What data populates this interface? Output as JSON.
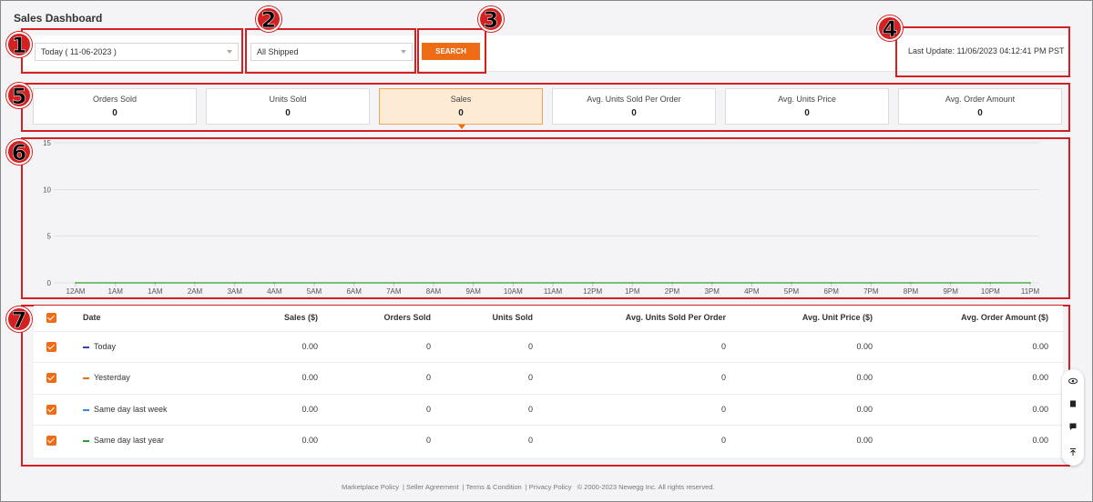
{
  "page": {
    "title": "Sales Dashboard"
  },
  "filters": {
    "date_range": "Today ( 11-06-2023 )",
    "status": "All Shipped",
    "search_label": "SEARCH",
    "last_update": "Last Update: 11/06/2023 04:12:41 PM PST"
  },
  "callouts": [
    "1",
    "2",
    "3",
    "4",
    "5",
    "6",
    "7"
  ],
  "stats": [
    {
      "label": "Orders Sold",
      "value": "0"
    },
    {
      "label": "Units Sold",
      "value": "0"
    },
    {
      "label": "Sales",
      "value": "0",
      "active": true
    },
    {
      "label": "Avg. Units Sold Per Order",
      "value": "0"
    },
    {
      "label": "Avg. Units Price",
      "value": "0"
    },
    {
      "label": "Avg. Order Amount",
      "value": "0"
    }
  ],
  "chart_data": {
    "type": "line",
    "y_ticks": [
      "15",
      "10",
      "5",
      "0"
    ],
    "ylim": [
      0,
      15
    ],
    "x": [
      "12AM",
      "1AM",
      "1AM",
      "2AM",
      "3AM",
      "4AM",
      "5AM",
      "6AM",
      "7AM",
      "8AM",
      "9AM",
      "10AM",
      "11AM",
      "12PM",
      "1PM",
      "2PM",
      "3PM",
      "4PM",
      "5PM",
      "6PM",
      "7PM",
      "8PM",
      "9PM",
      "10PM",
      "11PM"
    ],
    "series": [
      {
        "color": "#2aa02a",
        "values": [
          0,
          0,
          0,
          0,
          0,
          0,
          0,
          0,
          0,
          0,
          0,
          0,
          0,
          0,
          0,
          0,
          0,
          0,
          0,
          0,
          0,
          0,
          0,
          0,
          0
        ]
      }
    ],
    "grid": true
  },
  "table": {
    "headers": {
      "date": "Date",
      "sales": "Sales ($)",
      "orders": "Orders Sold",
      "units": "Units Sold",
      "avg_units": "Avg. Units Sold Per Order",
      "avg_price": "Avg. Unit Price ($)",
      "avg_order": "Avg. Order Amount ($)"
    },
    "rows": [
      {
        "date": "Today",
        "color": "#3344bb",
        "sales": "0.00",
        "orders": "0",
        "units": "0",
        "avg_units": "0",
        "avg_price": "0.00",
        "avg_order": "0.00"
      },
      {
        "date": "Yesterday",
        "color": "#ef6c16",
        "sales": "0.00",
        "orders": "0",
        "units": "0",
        "avg_units": "0",
        "avg_price": "0.00",
        "avg_order": "0.00"
      },
      {
        "date": "Same day last week",
        "color": "#3a86d8",
        "sales": "0.00",
        "orders": "0",
        "units": "0",
        "avg_units": "0",
        "avg_price": "0.00",
        "avg_order": "0.00"
      },
      {
        "date": "Same day last year",
        "color": "#2aa02a",
        "sales": "0.00",
        "orders": "0",
        "units": "0",
        "avg_units": "0",
        "avg_price": "0.00",
        "avg_order": "0.00"
      }
    ]
  },
  "footer": {
    "links": [
      "Marketplace Policy",
      "Seller Agreement",
      "Terms & Condition",
      "Privacy Policy"
    ],
    "copyright": "© 2000-2023 Newegg Inc. All rights reserved."
  },
  "side_tools": [
    "eye-icon",
    "book-icon",
    "chat-icon",
    "scroll-top-icon"
  ]
}
